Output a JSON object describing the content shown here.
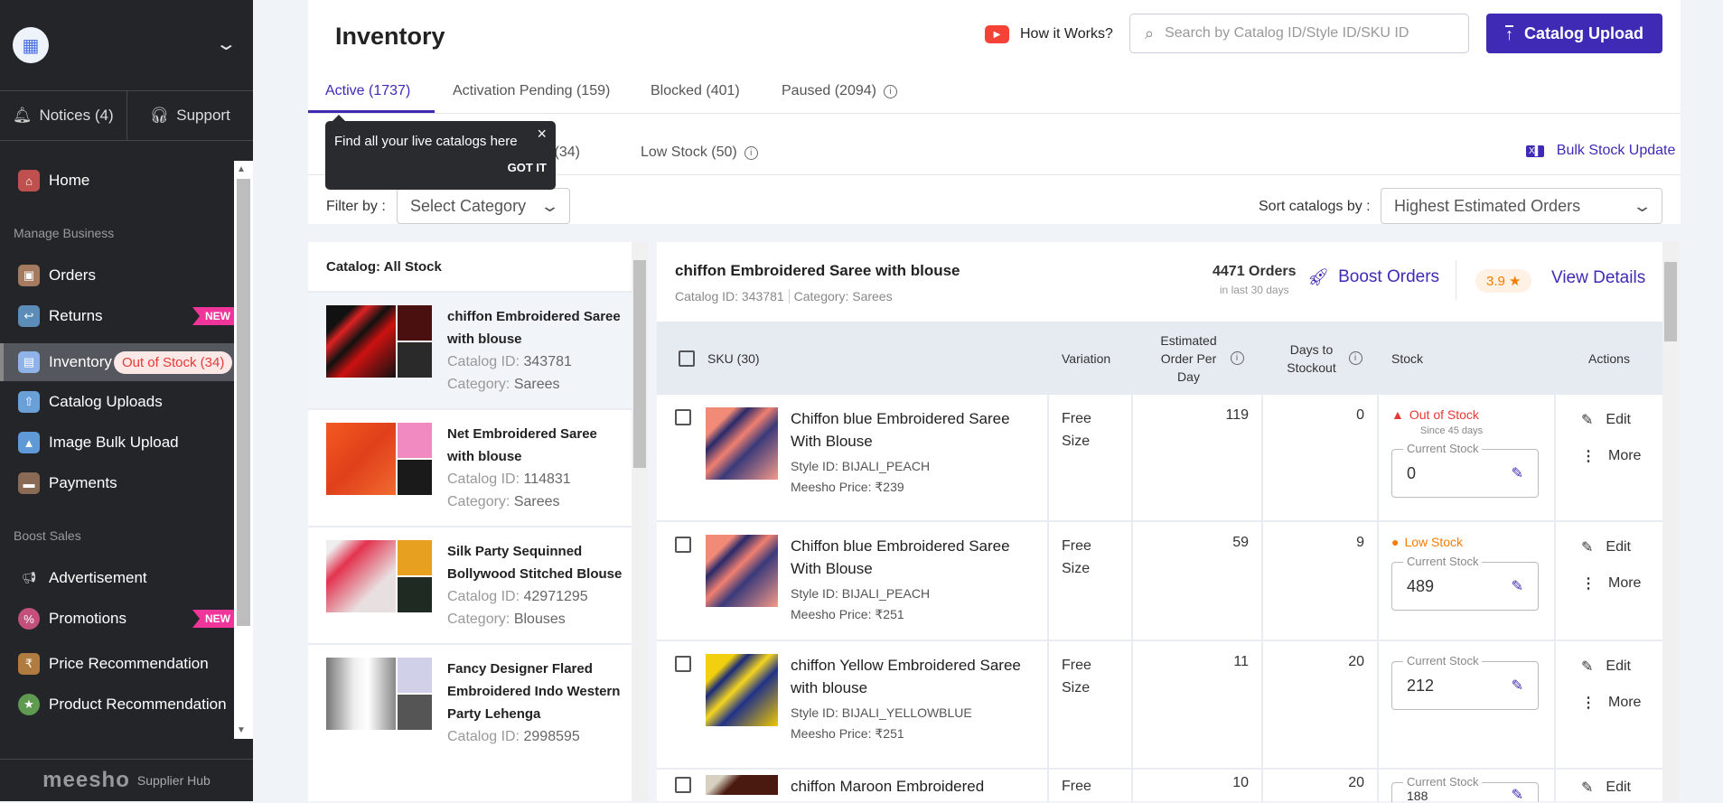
{
  "sidebar": {
    "notices": "Notices (4)",
    "support": "Support",
    "home": "Home",
    "section_manage": "Manage Business",
    "orders": "Orders",
    "returns": "Returns",
    "new_badge": "NEW",
    "inventory": "Inventory",
    "inventory_badge": "Out of Stock (34)",
    "catalog_uploads": "Catalog Uploads",
    "image_bulk": "Image Bulk Upload",
    "payments": "Payments",
    "section_boost": "Boost Sales",
    "advertisement": "Advertisement",
    "promotions": "Promotions",
    "price_rec": "Price Recommendation",
    "product_rec": "Product Recommendation",
    "brand": "meesho",
    "brand_sub": "Supplier Hub"
  },
  "header": {
    "title": "Inventory",
    "how": "How it Works?",
    "search_placeholder": "Search by Catalog ID/Style ID/SKU ID",
    "upload": "Catalog Upload"
  },
  "tabs": [
    "Active (1737)",
    "Activation Pending (159)",
    "Blocked (401)",
    "Paused (2094)"
  ],
  "subtabs": {
    "out_of_stock": "Out of Stock (34)",
    "low_stock": "Low Stock (50)",
    "bulk": "Bulk Stock Update"
  },
  "tooltip": {
    "text": "Find all your live catalogs here",
    "got_it": "GOT IT"
  },
  "filter": {
    "label": "Filter by :",
    "value": "Select Category"
  },
  "sort": {
    "label": "Sort catalogs by :",
    "value": "Highest Estimated Orders"
  },
  "catalog_list": {
    "header": "Catalog:  All Stock",
    "id_label": "Catalog ID:",
    "cat_label": "Category:",
    "items": [
      {
        "title": "chiffon Embroidered Saree with blouse",
        "id": "343781",
        "category": "Sarees"
      },
      {
        "title": "Net Embroidered Saree with blouse",
        "id": "114831",
        "category": "Sarees"
      },
      {
        "title": "Silk Party Sequinned Bollywood Stitched Blouse",
        "id": "42971295",
        "category": "Blouses"
      },
      {
        "title": "Fancy Designer Flared Embroidered Indo Western Party Lehenga",
        "id": "2998595",
        "category": ""
      }
    ]
  },
  "detail": {
    "title": "chiffon Embroidered Saree with blouse",
    "catalog_id": "Catalog ID: 343781",
    "category": "Category: Sarees",
    "orders": "4471 Orders",
    "orders_sub": "in last 30 days",
    "boost": "Boost Orders",
    "rating": "3.9 ★",
    "view": "View Details"
  },
  "table": {
    "headers": {
      "sku": "SKU (30)",
      "variation": "Variation",
      "est": "Estimated Order Per Day",
      "days": "Days to Stockout",
      "stock": "Stock",
      "actions": "Actions"
    },
    "current_stock_label": "Current Stock",
    "edit": "Edit",
    "more": "More",
    "rows": [
      {
        "name": "Chiffon blue Embroidered Saree With Blouse",
        "style": "Style ID:  BIJALI_PEACH",
        "price": "Meesho Price: ₹239",
        "variation": "Free Size",
        "est": "119",
        "days": "0",
        "status": "Out of Stock",
        "since": "Since 45 days",
        "stock": "0"
      },
      {
        "name": "Chiffon blue Embroidered Saree With Blouse",
        "style": "Style ID:  BIJALI_PEACH",
        "price": "Meesho Price: ₹251",
        "variation": "Free Size",
        "est": "59",
        "days": "9",
        "status": "Low Stock",
        "since": "",
        "stock": "489"
      },
      {
        "name": "chiffon Yellow Embroidered Saree with blouse",
        "style": "Style ID:  BIJALI_YELLOWBLUE",
        "price": "Meesho Price: ₹251",
        "variation": "Free Size",
        "est": "11",
        "days": "20",
        "status": "",
        "since": "",
        "stock": "212"
      },
      {
        "name": "chiffon Maroon Embroidered",
        "style": "",
        "price": "",
        "variation": "Free",
        "est": "10",
        "days": "20",
        "status": "",
        "since": "",
        "stock": "188"
      }
    ]
  },
  "colors": {
    "primary": "#3f2ab5",
    "danger": "#e53935",
    "warning": "#f57c00",
    "sidebar": "#242528"
  }
}
